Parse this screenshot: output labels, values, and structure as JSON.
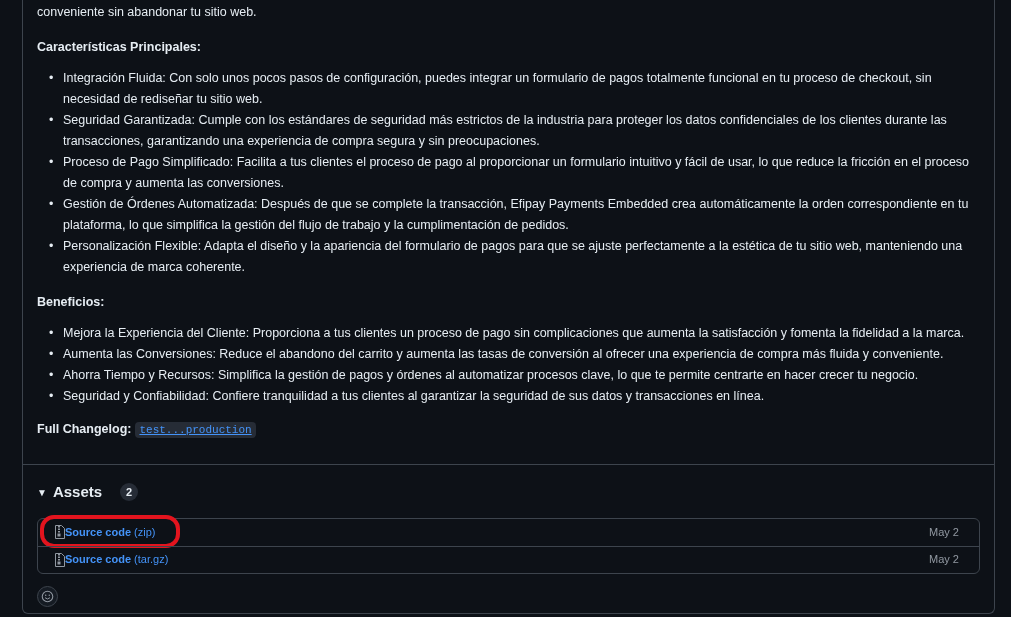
{
  "intro": "conveniente sin abandonar tu sitio web.",
  "sections": [
    {
      "heading": "Características Principales:",
      "items": [
        "Integración Fluida: Con solo unos pocos pasos de configuración, puedes integrar un formulario de pagos totalmente funcional en tu proceso de checkout, sin necesidad de rediseñar tu sitio web.",
        "Seguridad Garantizada: Cumple con los estándares de seguridad más estrictos de la industria para proteger los datos confidenciales de los clientes durante las transacciones, garantizando una experiencia de compra segura y sin preocupaciones.",
        "Proceso de Pago Simplificado: Facilita a tus clientes el proceso de pago al proporcionar un formulario intuitivo y fácil de usar, lo que reduce la fricción en el proceso de compra y aumenta las conversiones.",
        "Gestión de Órdenes Automatizada: Después de que se complete la transacción, Efipay Payments Embedded crea automáticamente la orden correspondiente en tu plataforma, lo que simplifica la gestión del flujo de trabajo y la cumplimentación de pedidos.",
        "Personalización Flexible: Adapta el diseño y la apariencia del formulario de pagos para que se ajuste perfectamente a la estética de tu sitio web, manteniendo una experiencia de marca coherente."
      ]
    },
    {
      "heading": "Beneficios:",
      "items": [
        "Mejora la Experiencia del Cliente: Proporciona a tus clientes un proceso de pago sin complicaciones que aumenta la satisfacción y fomenta la fidelidad a la marca.",
        "Aumenta las Conversiones: Reduce el abandono del carrito y aumenta las tasas de conversión al ofrecer una experiencia de compra más fluida y conveniente.",
        "Ahorra Tiempo y Recursos: Simplifica la gestión de pagos y órdenes al automatizar procesos clave, lo que te permite centrarte en hacer crecer tu negocio.",
        "Seguridad y Confiabilidad: Confiere tranquilidad a tus clientes al garantizar la seguridad de sus datos y transacciones en línea."
      ]
    }
  ],
  "changelog": {
    "label": "Full Changelog:",
    "link": "test...production"
  },
  "bullet": "•",
  "assets": {
    "toggle": "▼",
    "title": "Assets",
    "count": "2",
    "expanded": true,
    "items": [
      {
        "name": "Source code",
        "format": "(zip)",
        "date": "May 2",
        "circled": true
      },
      {
        "name": "Source code",
        "format": "(tar.gz)",
        "date": "May 2",
        "circled": false
      }
    ]
  }
}
